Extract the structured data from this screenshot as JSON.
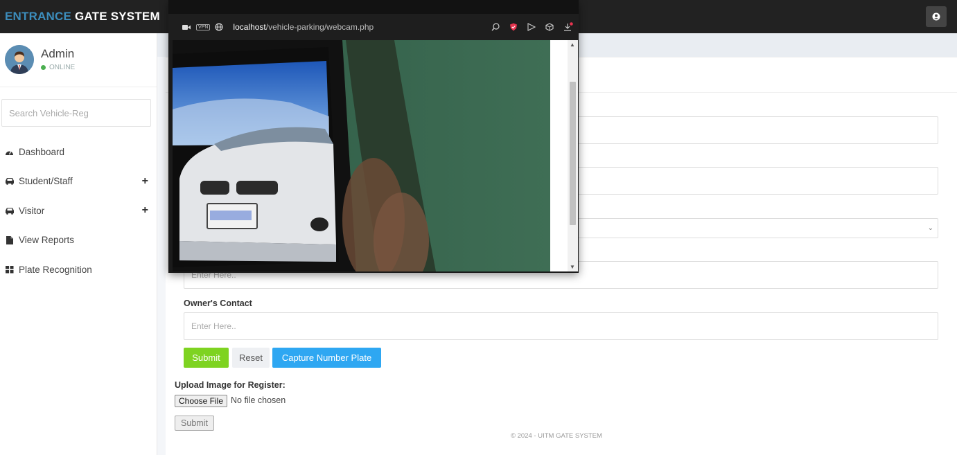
{
  "brand": {
    "part1": "ENTRANCE",
    "part2": "GATE SYSTEM"
  },
  "sidebar": {
    "user_name": "Admin",
    "user_status": "ONLINE",
    "search_placeholder": "Search Vehicle-Reg",
    "items": [
      {
        "label": "Dashboard",
        "icon": "dashboard-icon",
        "expandable": false
      },
      {
        "label": "Student/Staff",
        "icon": "car-icon",
        "expandable": true,
        "toggle": "+"
      },
      {
        "label": "Visitor",
        "icon": "car-icon",
        "expandable": true,
        "toggle": "+"
      },
      {
        "label": "View Reports",
        "icon": "file-icon",
        "expandable": false
      },
      {
        "label": "Plate Recognition",
        "icon": "grid-icon",
        "expandable": false
      }
    ]
  },
  "form": {
    "owner_name_placeholder": "Enter Here..",
    "owner_contact_label": "Owner's Contact",
    "owner_contact_placeholder": "Enter Here..",
    "submit_label": "Submit",
    "reset_label": "Reset",
    "capture_label": "Capture Number Plate"
  },
  "upload": {
    "label": "Upload Image for Register:",
    "choose_label": "Choose File",
    "no_file_text": "No file chosen",
    "submit_label": "Submit"
  },
  "footer": {
    "text": "© 2024 - UITM GATE SYSTEM"
  },
  "popup": {
    "url_host": "localhost",
    "url_path": "/vehicle-parking/webcam.php",
    "vpn_label": "VPN"
  },
  "colors": {
    "brand_accent": "#3c8dbc",
    "submit": "#7ed321",
    "capture": "#2ea7f2",
    "online": "#4caf50"
  }
}
